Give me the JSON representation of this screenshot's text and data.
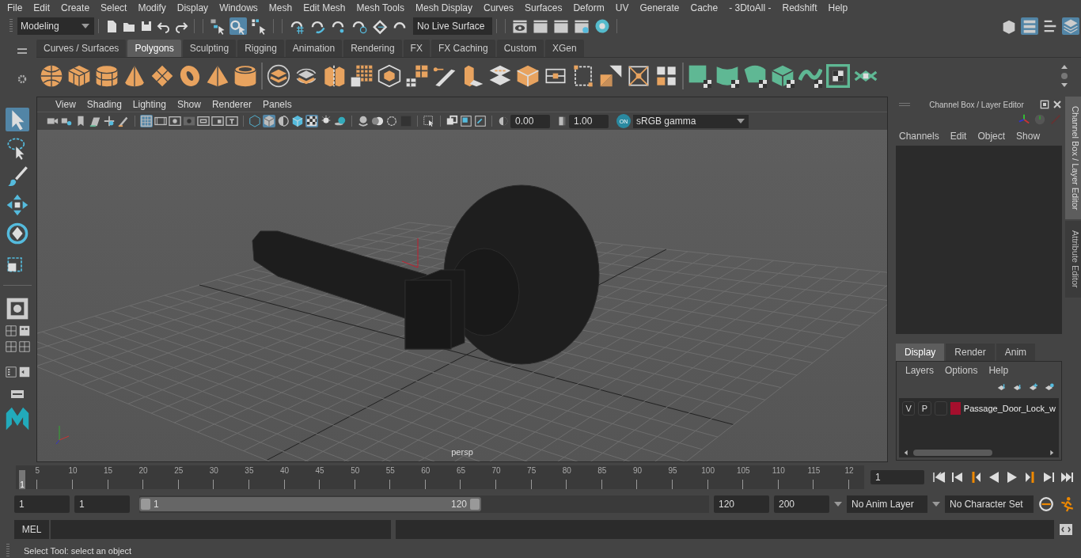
{
  "menu_bar": {
    "items": [
      "File",
      "Edit",
      "Create",
      "Select",
      "Modify",
      "Display",
      "Windows",
      "Mesh",
      "Edit Mesh",
      "Mesh Tools",
      "Mesh Display",
      "Curves",
      "Surfaces",
      "Deform",
      "UV",
      "Generate",
      "Cache",
      "- 3DtoAll -",
      "Redshift",
      "Help"
    ]
  },
  "status_line": {
    "workspace": "Modeling",
    "live_surface": "No Live Surface",
    "selection_modes": [
      {
        "selected": false
      },
      {
        "selected": true
      },
      {
        "selected": false
      }
    ],
    "panel_toggles": [
      {
        "selected": false
      },
      {
        "selected": true
      },
      {
        "selected": false
      },
      {
        "selected": true
      }
    ]
  },
  "shelf": {
    "tabs": [
      {
        "label": "Curves / Surfaces",
        "selected": false
      },
      {
        "label": "Polygons",
        "selected": true
      },
      {
        "label": "Sculpting",
        "selected": false
      },
      {
        "label": "Rigging",
        "selected": false
      },
      {
        "label": "Animation",
        "selected": false
      },
      {
        "label": "Rendering",
        "selected": false
      },
      {
        "label": "FX",
        "selected": false
      },
      {
        "label": "FX Caching",
        "selected": false
      },
      {
        "label": "Custom",
        "selected": false
      },
      {
        "label": "XGen",
        "selected": false
      }
    ]
  },
  "toolbox": {
    "tools": [
      {
        "selected": true
      },
      {
        "selected": false
      },
      {
        "selected": false
      },
      {
        "selected": false
      },
      {
        "selected": false
      },
      {
        "selected": false
      }
    ]
  },
  "viewport": {
    "menus": [
      "View",
      "Shading",
      "Lighting",
      "Show",
      "Renderer",
      "Panels"
    ],
    "tools": [
      {
        "selected": false
      },
      {
        "selected": false
      },
      {
        "selected": false
      },
      {
        "selected": false
      },
      {
        "selected": false
      },
      {
        "selected": false
      },
      {
        "selected": true
      },
      {
        "selected": false
      },
      {
        "selected": false
      },
      {
        "selected": false
      },
      {
        "selected": false
      },
      {
        "selected": false
      },
      {
        "selected": false
      },
      {
        "selected": false
      },
      {
        "selected": true
      },
      {
        "selected": false
      },
      {
        "selected": false
      },
      {
        "selected": true
      },
      {
        "selected": false
      },
      {
        "selected": false
      },
      {
        "selected": false
      },
      {
        "selected": false
      },
      {
        "selected": false
      },
      {
        "selected": false
      },
      {
        "selected": false
      },
      {
        "selected": false
      },
      {
        "selected": false
      },
      {
        "selected": false
      }
    ],
    "exposure": "0.00",
    "gamma": "1.00",
    "color_management": "ON",
    "color_space": "sRGB gamma",
    "camera_label": "persp"
  },
  "channel_box": {
    "title": "Channel Box / Layer Editor",
    "menus": [
      "Channels",
      "Edit",
      "Object",
      "Show"
    ],
    "layer_tabs": [
      {
        "label": "Display",
        "selected": true
      },
      {
        "label": "Render",
        "selected": false
      },
      {
        "label": "Anim",
        "selected": false
      }
    ],
    "layer_menus": [
      "Layers",
      "Options",
      "Help"
    ],
    "layers": [
      {
        "visible": "V",
        "playback": "P",
        "color": "#a50f2d",
        "name": "Passage_Door_Lock_w"
      }
    ]
  },
  "side_tabs": [
    {
      "label": "Channel Box / Layer Editor",
      "selected": true
    },
    {
      "label": "Attribute Editor",
      "selected": false
    }
  ],
  "timeline": {
    "current_marker": "1",
    "level": 0,
    "frames": [
      "5",
      "10",
      "15",
      "20",
      "25",
      "30",
      "35",
      "40",
      "45",
      "50",
      "55",
      "60",
      "65",
      "70",
      "75",
      "80",
      "85",
      "90",
      "95",
      "100",
      "105",
      "110",
      "115",
      "12"
    ],
    "current_frame": "1"
  },
  "range": {
    "level": 0.6,
    "start": "1",
    "playback_start": "1",
    "slider_start": "1",
    "slider_end": "120",
    "playback_end": "120",
    "end": "200",
    "anim_layer": "No Anim Layer",
    "character_set": "No Character Set"
  },
  "command_line": {
    "language": "MEL"
  },
  "help_line": {
    "text": "Select Tool: select an object"
  }
}
